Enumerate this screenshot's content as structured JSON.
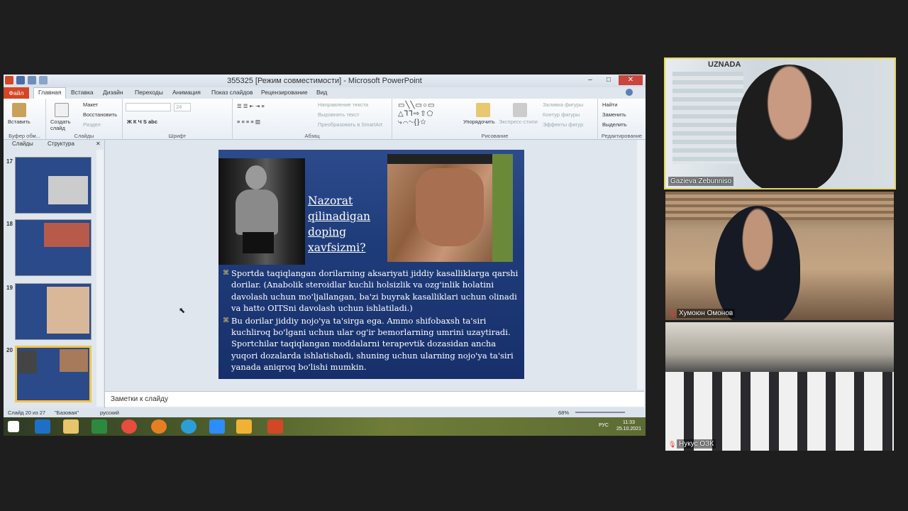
{
  "window": {
    "title": "355325 [Режим совместимости] - Microsoft PowerPoint"
  },
  "tabs": [
    "Файл",
    "Главная",
    "Вставка",
    "Дизайн",
    "Переходы",
    "Анимация",
    "Показ слайдов",
    "Рецензирование",
    "Вид"
  ],
  "ribbon": {
    "clipboard": {
      "paste": "Вставить",
      "label": "Буфер обм..."
    },
    "slides": {
      "new_slide": "Создать слайд",
      "layout": "Макет",
      "restore": "Восстановить",
      "section": "Раздел",
      "label": "Слайды"
    },
    "font": {
      "size": "24",
      "label": "Шрифт"
    },
    "paragraph": {
      "direction": "Направление текста",
      "align": "Выровнять текст",
      "smartart": "Преобразовать в SmartArt",
      "label": "Абзац"
    },
    "drawing": {
      "arrange": "Упорядочить",
      "styles": "Экспресс-стили",
      "fill": "Заливка фигуры",
      "outline": "Контур фигуры",
      "effects": "Эффекты фигур",
      "label": "Рисование"
    },
    "editing": {
      "find": "Найти",
      "replace": "Заменить",
      "select": "Выделить",
      "label": "Редактирование"
    }
  },
  "left_pane": {
    "tab_slides": "Слайды",
    "tab_outline": "Структура",
    "slide_numbers": [
      "17",
      "18",
      "19",
      "20"
    ]
  },
  "slide": {
    "title_lines": [
      "Nazorat",
      "qilinadigan",
      "doping",
      "xavfsizmi?"
    ],
    "bullets": [
      "Sportda taqiqlangan dorilarning aksariyati jiddiy kasalliklarga qarshi dorilar. (Anabolik steroidlar kuchli holsizlik va ozg'inlik holatini davolash uchun mo'ljallangan, ba'zi buyrak kasalliklari uchun olinadi va  hatto OITSni davolash uchun ishlatiladi.)",
      "Bu dorilar jiddiy nojo'ya ta'sirga ega. Ammo shifobaxsh ta'siri kuchliroq bo'lgani uchun ular og'ir bemorlarning umrini uzaytiradi. Sportchilar taqiqlangan moddalarni terapevtik dozasidan ancha yuqori dozalarda ishlatishadi, shuning uchun ularning nojo'ya ta'siri yanada aniqroq bo'lishi mumkin."
    ]
  },
  "notes": {
    "placeholder": "Заметки к слайду"
  },
  "status": {
    "slide": "Слайд 20 из 27",
    "theme": "\"Базовая\"",
    "lang": "русский",
    "zoom": "68%"
  },
  "taskbar": {
    "lang": "РУС",
    "time": "11:33",
    "date": "25.10.2021"
  },
  "video": {
    "participant1": "Gazieva Zebunniso",
    "participant2": "Хумоюн Омонов",
    "participant3": "Нукус ОЗК",
    "backdrop_text": "UZNADA"
  }
}
